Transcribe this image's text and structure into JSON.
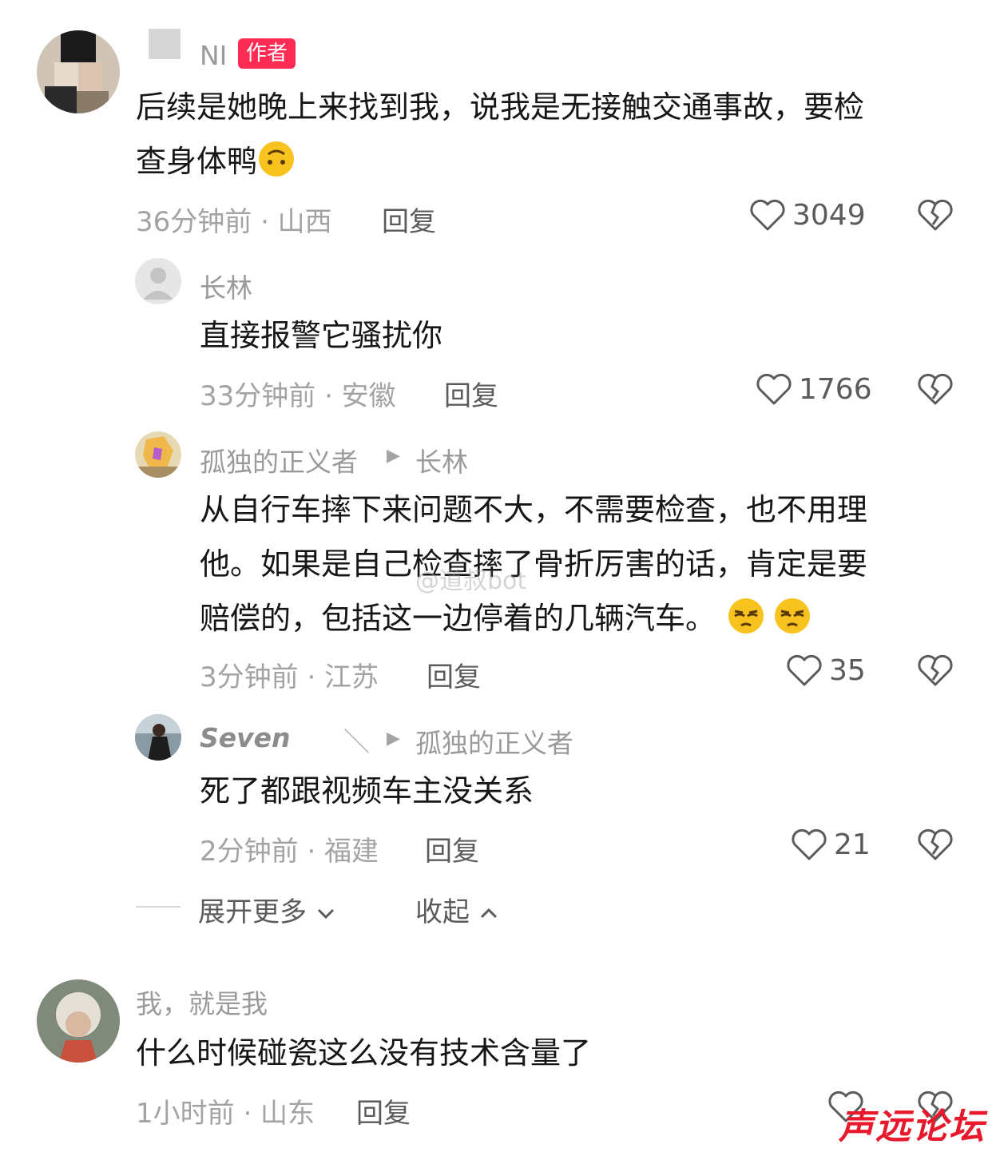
{
  "watermark": "@道叔bot",
  "brand_logo_text": "声远论坛",
  "comments": [
    {
      "name": "NI",
      "badge": "作者",
      "text_line1": "后续是她晚上来找到我，说我是无接触交通事故，要检",
      "text_line2": "查身体鸭",
      "meta": "36分钟前 · 山西",
      "reply": "回复",
      "likes": "3049"
    },
    {
      "name": "长林",
      "text": "直接报警它骚扰你",
      "meta": "33分钟前 · 安徽",
      "reply": "回复",
      "likes": "1766"
    },
    {
      "name": "孤独的正义者",
      "reply_to": "长林",
      "text_line1": "从自行车摔下来问题不大，不需要检查，也不用理",
      "text_line2": "他。如果是自己检查摔了骨折厉害的话，肯定是要",
      "text_line3": "赔偿的，包括这一边停着的几辆汽车。",
      "meta": "3分钟前 · 江苏",
      "reply": "回复",
      "likes": "35"
    },
    {
      "name": "Seven",
      "name_suffix": "＼",
      "reply_to": "孤独的正义者",
      "text": "死了都跟视频车主没关系",
      "meta": "2分钟前 · 福建",
      "reply": "回复",
      "likes": "21"
    },
    {
      "name": "我，就是我",
      "text": "什么时候碰瓷这么没有技术含量了",
      "meta": "1小时前 · 山东",
      "reply": "回复"
    }
  ],
  "expand": {
    "more": "展开更多",
    "collapse": "收起"
  },
  "colors": {
    "badge": "#fe2c55",
    "meta": "#a3a3a3",
    "text": "#161616"
  }
}
